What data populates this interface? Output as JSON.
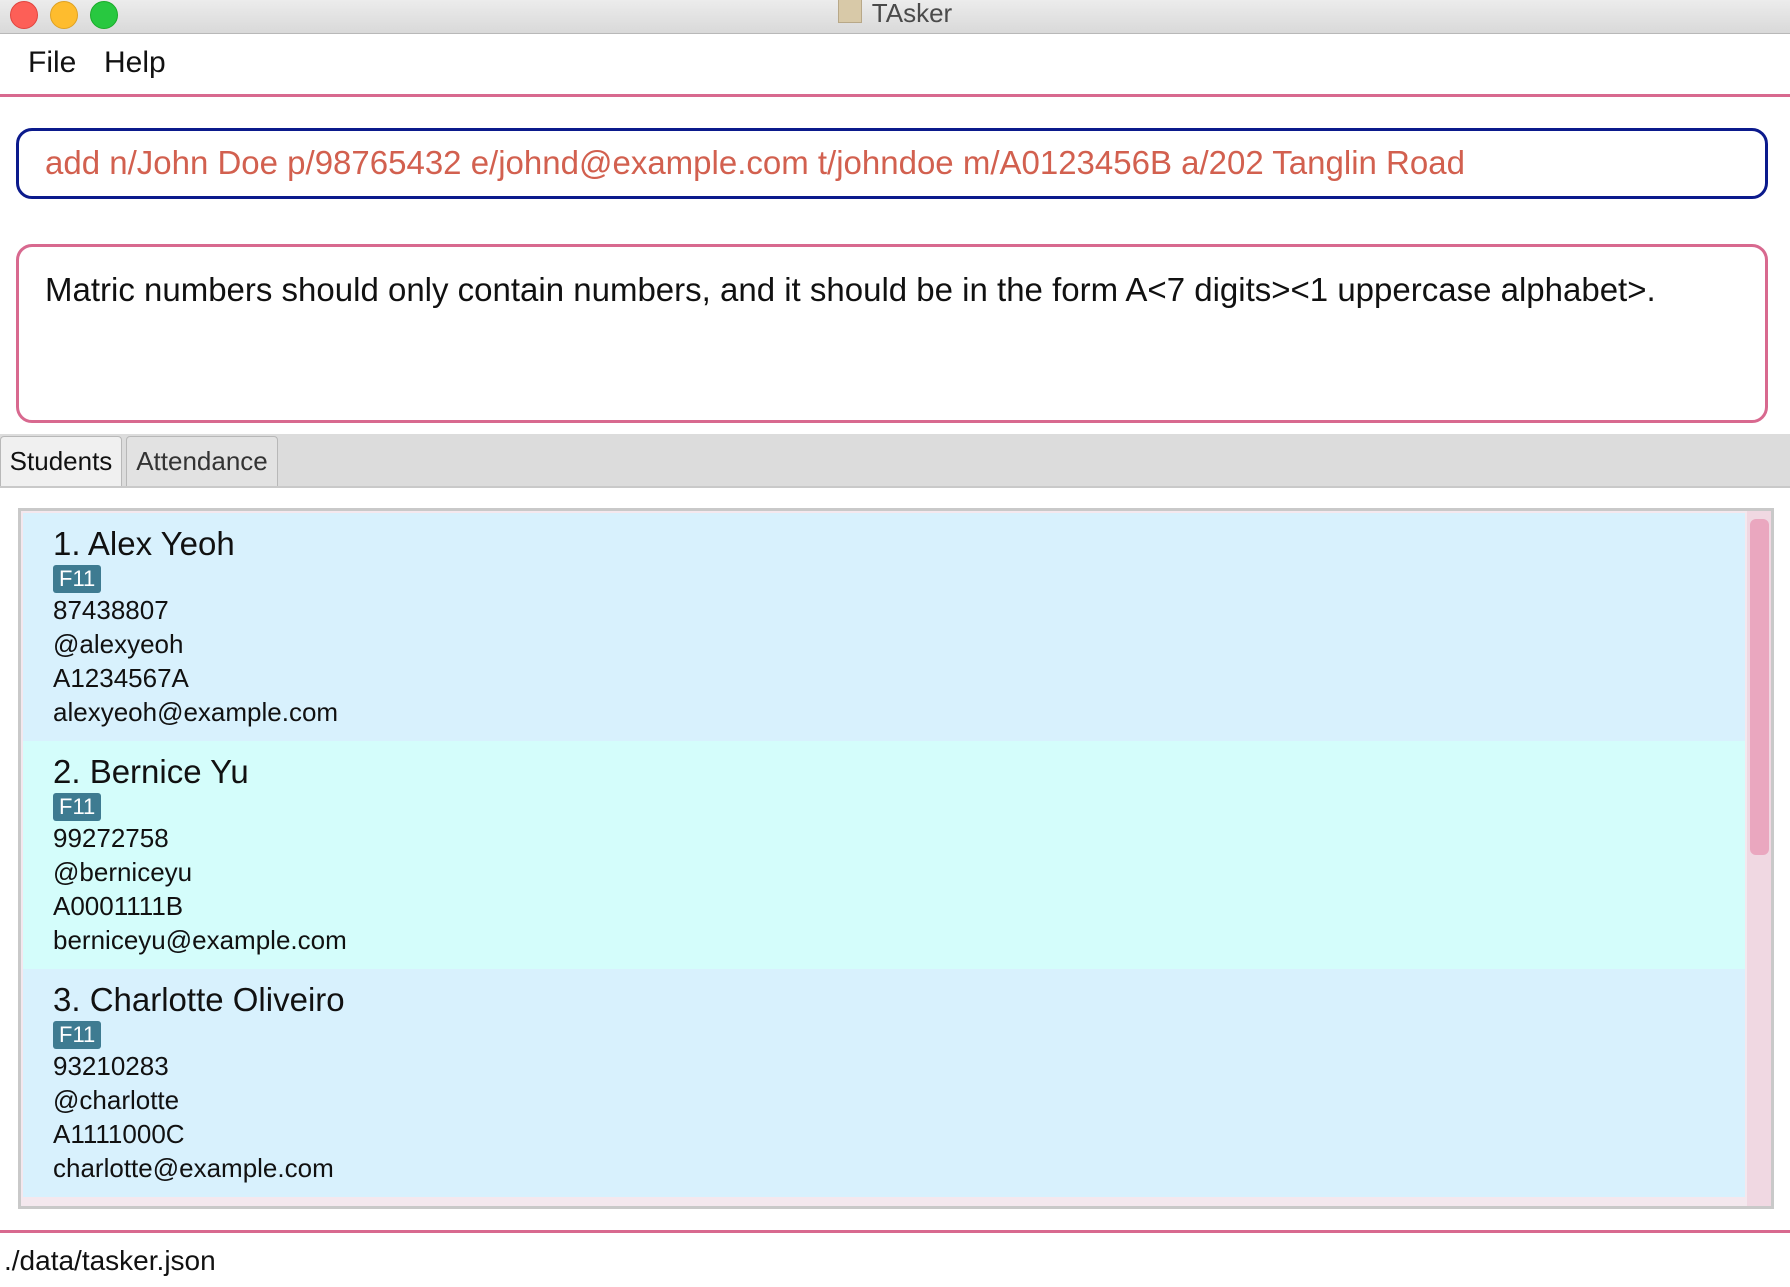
{
  "window": {
    "title": "TAsker"
  },
  "menu": {
    "items": [
      "File",
      "Help"
    ]
  },
  "command": {
    "value": "add n/John Doe p/98765432 e/johnd@example.com t/johndoe m/A0123456B a/202 Tanglin Road"
  },
  "result": {
    "message": "Matric numbers should only contain numbers, and it should be in the form A<7 digits><1 uppercase alphabet>."
  },
  "tabs": [
    {
      "label": "Students",
      "selected": true
    },
    {
      "label": "Attendance",
      "selected": false
    }
  ],
  "students": [
    {
      "name": "1.  Alex Yeoh",
      "tag": "F11",
      "phone": "87438807",
      "telegram": "@alexyeoh",
      "matric": "A1234567A",
      "email": "alexyeoh@example.com"
    },
    {
      "name": "2.  Bernice Yu",
      "tag": "F11",
      "phone": "99272758",
      "telegram": "@berniceyu",
      "matric": "A0001111B",
      "email": "berniceyu@example.com"
    },
    {
      "name": "3.  Charlotte Oliveiro",
      "tag": "F11",
      "phone": "93210283",
      "telegram": "@charlotte",
      "matric": "A1111000C",
      "email": "charlotte@example.com"
    }
  ],
  "status": {
    "path": "./data/tasker.json"
  },
  "colors": {
    "accent": "#d8698f",
    "command_border": "#0b1a8c",
    "command_text": "#d2604f",
    "card_odd": "#d8f1fd",
    "card_even": "#d4fdfb",
    "tag": "#3e7b91"
  },
  "scroll": {
    "thumb_fraction": 0.48
  }
}
